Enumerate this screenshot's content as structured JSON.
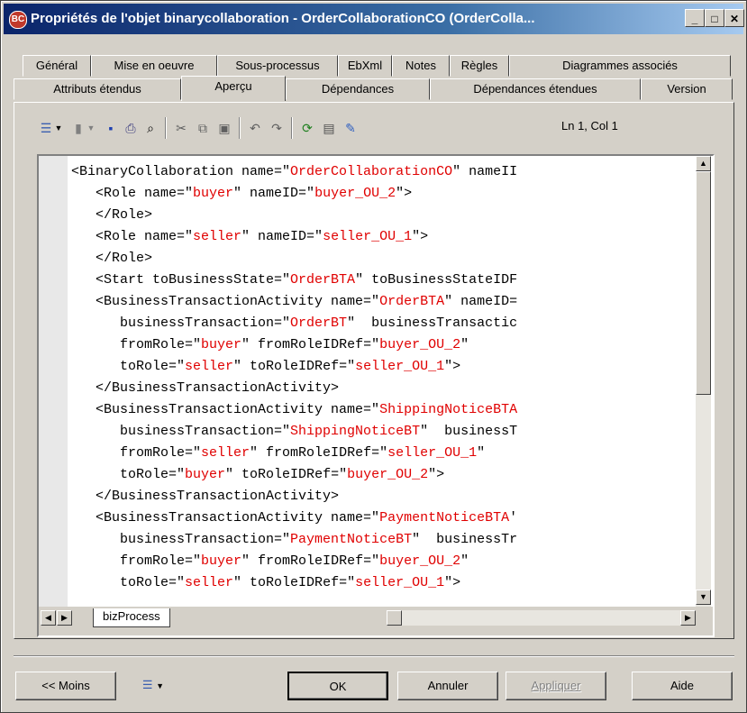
{
  "window": {
    "title": "Propriétés de l'objet binarycollaboration - OrderCollaborationCO (OrderColla...",
    "icon_text": "BC",
    "controls": [
      "_",
      "□",
      "✕"
    ]
  },
  "tabs_row1": [
    "Général",
    "Mise en oeuvre",
    "Sous-processus",
    "EbXml",
    "Notes",
    "Règles",
    "Diagrammes associés"
  ],
  "tabs_row2": [
    "Attributs étendus",
    "Aperçu",
    "Dépendances",
    "Dépendances étendues",
    "Version"
  ],
  "active_tab": "Aperçu",
  "toolbar": {
    "icons": [
      "print-preview-icon",
      "dropdown-icon",
      "new-icon",
      "dropdown-icon",
      "save-icon",
      "print-icon",
      "find-icon",
      "cut-icon",
      "copy-icon",
      "paste-icon",
      "undo-icon",
      "redo-icon",
      "refresh-icon",
      "script-icon",
      "edit-icon"
    ],
    "position": "Ln 1, Col 1"
  },
  "code_lines": [
    [
      "<BinaryCollaboration name=\"",
      "OrderCollaborationCO",
      "\" nameII"
    ],
    [
      "   <Role name=\"",
      "buyer",
      "\" nameID=\"",
      "buyer_OU_2",
      "\">"
    ],
    [
      "   </Role>"
    ],
    [
      "   <Role name=\"",
      "seller",
      "\" nameID=\"",
      "seller_OU_1",
      "\">"
    ],
    [
      "   </Role>"
    ],
    [
      "   <Start toBusinessState=\"",
      "OrderBTA",
      "\" toBusinessStateIDF"
    ],
    [
      "   <BusinessTransactionActivity name=\"",
      "OrderBTA",
      "\" nameID="
    ],
    [
      "      businessTransaction=\"",
      "OrderBT",
      "\"  businessTransactic"
    ],
    [
      "      fromRole=\"",
      "buyer",
      "\" fromRoleIDRef=\"",
      "buyer_OU_2",
      "\""
    ],
    [
      "      toRole=\"",
      "seller",
      "\" toRoleIDRef=\"",
      "seller_OU_1",
      "\">"
    ],
    [
      "   </BusinessTransactionActivity>"
    ],
    [
      "   <BusinessTransactionActivity name=\"",
      "ShippingNoticeBTA",
      ""
    ],
    [
      "      businessTransaction=\"",
      "ShippingNoticeBT",
      "\"  businessT"
    ],
    [
      "      fromRole=\"",
      "seller",
      "\" fromRoleIDRef=\"",
      "seller_OU_1",
      "\""
    ],
    [
      "      toRole=\"",
      "buyer",
      "\" toRoleIDRef=\"",
      "buyer_OU_2",
      "\">"
    ],
    [
      "   </BusinessTransactionActivity>"
    ],
    [
      "   <BusinessTransactionActivity name=\"",
      "PaymentNoticeBTA",
      "'"
    ],
    [
      "      businessTransaction=\"",
      "PaymentNoticeBT",
      "\"  businessTr"
    ],
    [
      "      fromRole=\"",
      "buyer",
      "\" fromRoleIDRef=\"",
      "buyer_OU_2",
      "\""
    ],
    [
      "      toRole=\"",
      "seller",
      "\" toRoleIDRef=\"",
      "seller_OU_1",
      "\">"
    ]
  ],
  "sheet_tab": "bizProcess",
  "buttons": {
    "less": "<< Moins",
    "ok": "OK",
    "cancel": "Annuler",
    "apply": "Appliquer",
    "help": "Aide"
  },
  "colors": {
    "string": "#e00000",
    "titlebar": "#0a246a"
  }
}
